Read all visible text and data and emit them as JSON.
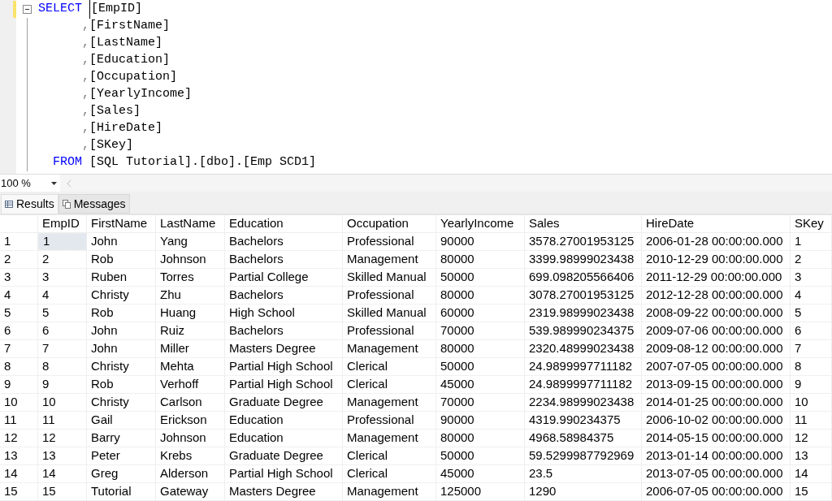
{
  "editor": {
    "lines": [
      {
        "kind": "select",
        "keyword": "SELECT",
        "text": "[EmpID]",
        "changed": true
      },
      {
        "kind": "column",
        "punct": ",",
        "text": "[FirstName]",
        "changed": false
      },
      {
        "kind": "column",
        "punct": ",",
        "text": "[LastName]",
        "changed": false
      },
      {
        "kind": "column",
        "punct": ",",
        "text": "[Education]",
        "changed": false
      },
      {
        "kind": "column",
        "punct": ",",
        "text": "[Occupation]",
        "changed": false
      },
      {
        "kind": "column",
        "punct": ",",
        "text": "[YearlyIncome]",
        "changed": false
      },
      {
        "kind": "column",
        "punct": ",",
        "text": "[Sales]",
        "changed": false
      },
      {
        "kind": "column",
        "punct": ",",
        "text": "[HireDate]",
        "changed": false
      },
      {
        "kind": "column",
        "punct": ",",
        "text": "[SKey]",
        "changed": false
      },
      {
        "kind": "from",
        "keyword": "FROM",
        "text": "[SQL Tutorial].[dbo].[Emp SCD1]",
        "changed": false
      }
    ]
  },
  "zoom": {
    "value": "100 %"
  },
  "tabs": [
    {
      "label": "Results",
      "selected": true
    },
    {
      "label": "Messages",
      "selected": false
    }
  ],
  "grid": {
    "columns": [
      "EmpID",
      "FirstName",
      "LastName",
      "Education",
      "Occupation",
      "YearlyIncome",
      "Sales",
      "HireDate",
      "SKey"
    ],
    "rows": [
      {
        "number": "1",
        "selected": true,
        "cells": [
          "1",
          "John",
          "Yang",
          "Bachelors",
          "Professional",
          "90000",
          "3578.27001953125",
          "2006-01-28 00:00:00.000",
          "1"
        ]
      },
      {
        "number": "2",
        "selected": false,
        "cells": [
          "2",
          "Rob",
          "Johnson",
          "Bachelors",
          "Management",
          "80000",
          "3399.98999023438",
          "2010-12-29 00:00:00.000",
          "2"
        ]
      },
      {
        "number": "3",
        "selected": false,
        "cells": [
          "3",
          "Ruben",
          "Torres",
          "Partial College",
          "Skilled Manual",
          "50000",
          "699.098205566406",
          "2011-12-29 00:00:00.000",
          "3"
        ]
      },
      {
        "number": "4",
        "selected": false,
        "cells": [
          "4",
          "Christy",
          "Zhu",
          "Bachelors",
          "Professional",
          "80000",
          "3078.27001953125",
          "2012-12-28 00:00:00.000",
          "4"
        ]
      },
      {
        "number": "5",
        "selected": false,
        "cells": [
          "5",
          "Rob",
          "Huang",
          "High School",
          "Skilled Manual",
          "60000",
          "2319.98999023438",
          "2008-09-22 00:00:00.000",
          "5"
        ]
      },
      {
        "number": "6",
        "selected": false,
        "cells": [
          "6",
          "John",
          "Ruiz",
          "Bachelors",
          "Professional",
          "70000",
          "539.989990234375",
          "2009-07-06 00:00:00.000",
          "6"
        ]
      },
      {
        "number": "7",
        "selected": false,
        "cells": [
          "7",
          "John",
          "Miller",
          "Masters Degree",
          "Management",
          "80000",
          "2320.48999023438",
          "2009-08-12 00:00:00.000",
          "7"
        ]
      },
      {
        "number": "8",
        "selected": false,
        "cells": [
          "8",
          "Christy",
          "Mehta",
          "Partial High School",
          "Clerical",
          "50000",
          "24.9899997711182",
          "2007-07-05 00:00:00.000",
          "8"
        ]
      },
      {
        "number": "9",
        "selected": false,
        "cells": [
          "9",
          "Rob",
          "Verhoff",
          "Partial High School",
          "Clerical",
          "45000",
          "24.9899997711182",
          "2013-09-15 00:00:00.000",
          "9"
        ]
      },
      {
        "number": "10",
        "selected": false,
        "cells": [
          "10",
          "Christy",
          "Carlson",
          "Graduate Degree",
          "Management",
          "70000",
          "2234.98999023438",
          "2014-01-25 00:00:00.000",
          "10"
        ]
      },
      {
        "number": "11",
        "selected": false,
        "cells": [
          "11",
          "Gail",
          "Erickson",
          "Education",
          "Professional",
          "90000",
          "4319.990234375",
          "2006-10-02 00:00:00.000",
          "11"
        ]
      },
      {
        "number": "12",
        "selected": false,
        "cells": [
          "12",
          "Barry",
          "Johnson",
          "Education",
          "Management",
          "80000",
          "4968.58984375",
          "2014-05-15 00:00:00.000",
          "12"
        ]
      },
      {
        "number": "13",
        "selected": false,
        "cells": [
          "13",
          "Peter",
          "Krebs",
          "Graduate Degree",
          "Clerical",
          "50000",
          "59.5299987792969",
          "2013-01-14 00:00:00.000",
          "13"
        ]
      },
      {
        "number": "14",
        "selected": false,
        "cells": [
          "14",
          "Greg",
          "Alderson",
          "Partial High School",
          "Clerical",
          "45000",
          "23.5",
          "2013-07-05 00:00:00.000",
          "14"
        ]
      },
      {
        "number": "15",
        "selected": false,
        "cells": [
          "15",
          "Tutorial",
          "Gateway",
          "Masters Degree",
          "Management",
          "125000",
          "1290",
          "2006-07-05 00:00:00.000",
          "15"
        ]
      }
    ]
  }
}
